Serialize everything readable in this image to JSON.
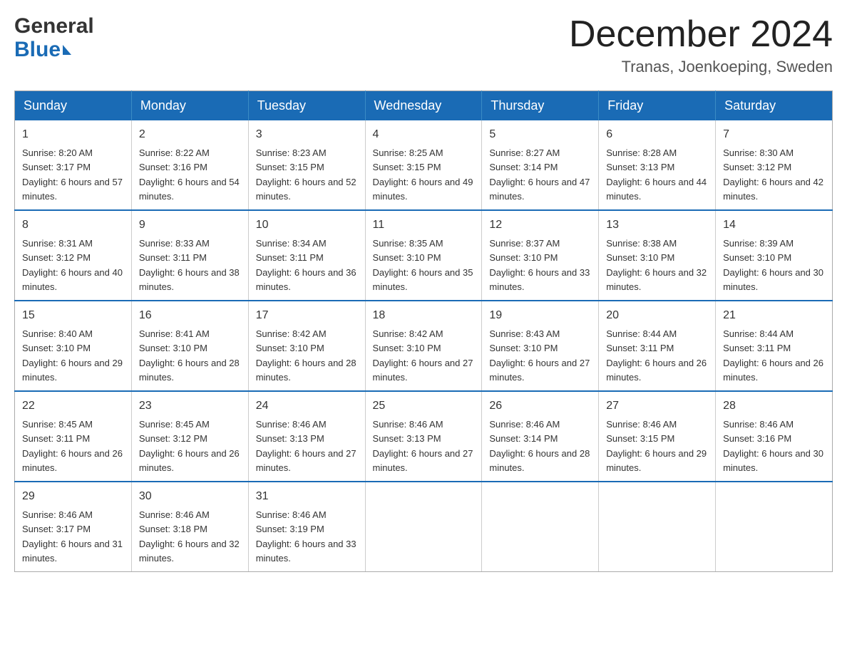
{
  "header": {
    "logo_line1": "General",
    "logo_line2": "Blue",
    "month_title": "December 2024",
    "location": "Tranas, Joenkoeping, Sweden"
  },
  "weekdays": [
    "Sunday",
    "Monday",
    "Tuesday",
    "Wednesday",
    "Thursday",
    "Friday",
    "Saturday"
  ],
  "weeks": [
    [
      {
        "day": "1",
        "sunrise": "8:20 AM",
        "sunset": "3:17 PM",
        "daylight": "6 hours and 57 minutes."
      },
      {
        "day": "2",
        "sunrise": "8:22 AM",
        "sunset": "3:16 PM",
        "daylight": "6 hours and 54 minutes."
      },
      {
        "day": "3",
        "sunrise": "8:23 AM",
        "sunset": "3:15 PM",
        "daylight": "6 hours and 52 minutes."
      },
      {
        "day": "4",
        "sunrise": "8:25 AM",
        "sunset": "3:15 PM",
        "daylight": "6 hours and 49 minutes."
      },
      {
        "day": "5",
        "sunrise": "8:27 AM",
        "sunset": "3:14 PM",
        "daylight": "6 hours and 47 minutes."
      },
      {
        "day": "6",
        "sunrise": "8:28 AM",
        "sunset": "3:13 PM",
        "daylight": "6 hours and 44 minutes."
      },
      {
        "day": "7",
        "sunrise": "8:30 AM",
        "sunset": "3:12 PM",
        "daylight": "6 hours and 42 minutes."
      }
    ],
    [
      {
        "day": "8",
        "sunrise": "8:31 AM",
        "sunset": "3:12 PM",
        "daylight": "6 hours and 40 minutes."
      },
      {
        "day": "9",
        "sunrise": "8:33 AM",
        "sunset": "3:11 PM",
        "daylight": "6 hours and 38 minutes."
      },
      {
        "day": "10",
        "sunrise": "8:34 AM",
        "sunset": "3:11 PM",
        "daylight": "6 hours and 36 minutes."
      },
      {
        "day": "11",
        "sunrise": "8:35 AM",
        "sunset": "3:10 PM",
        "daylight": "6 hours and 35 minutes."
      },
      {
        "day": "12",
        "sunrise": "8:37 AM",
        "sunset": "3:10 PM",
        "daylight": "6 hours and 33 minutes."
      },
      {
        "day": "13",
        "sunrise": "8:38 AM",
        "sunset": "3:10 PM",
        "daylight": "6 hours and 32 minutes."
      },
      {
        "day": "14",
        "sunrise": "8:39 AM",
        "sunset": "3:10 PM",
        "daylight": "6 hours and 30 minutes."
      }
    ],
    [
      {
        "day": "15",
        "sunrise": "8:40 AM",
        "sunset": "3:10 PM",
        "daylight": "6 hours and 29 minutes."
      },
      {
        "day": "16",
        "sunrise": "8:41 AM",
        "sunset": "3:10 PM",
        "daylight": "6 hours and 28 minutes."
      },
      {
        "day": "17",
        "sunrise": "8:42 AM",
        "sunset": "3:10 PM",
        "daylight": "6 hours and 28 minutes."
      },
      {
        "day": "18",
        "sunrise": "8:42 AM",
        "sunset": "3:10 PM",
        "daylight": "6 hours and 27 minutes."
      },
      {
        "day": "19",
        "sunrise": "8:43 AM",
        "sunset": "3:10 PM",
        "daylight": "6 hours and 27 minutes."
      },
      {
        "day": "20",
        "sunrise": "8:44 AM",
        "sunset": "3:11 PM",
        "daylight": "6 hours and 26 minutes."
      },
      {
        "day": "21",
        "sunrise": "8:44 AM",
        "sunset": "3:11 PM",
        "daylight": "6 hours and 26 minutes."
      }
    ],
    [
      {
        "day": "22",
        "sunrise": "8:45 AM",
        "sunset": "3:11 PM",
        "daylight": "6 hours and 26 minutes."
      },
      {
        "day": "23",
        "sunrise": "8:45 AM",
        "sunset": "3:12 PM",
        "daylight": "6 hours and 26 minutes."
      },
      {
        "day": "24",
        "sunrise": "8:46 AM",
        "sunset": "3:13 PM",
        "daylight": "6 hours and 27 minutes."
      },
      {
        "day": "25",
        "sunrise": "8:46 AM",
        "sunset": "3:13 PM",
        "daylight": "6 hours and 27 minutes."
      },
      {
        "day": "26",
        "sunrise": "8:46 AM",
        "sunset": "3:14 PM",
        "daylight": "6 hours and 28 minutes."
      },
      {
        "day": "27",
        "sunrise": "8:46 AM",
        "sunset": "3:15 PM",
        "daylight": "6 hours and 29 minutes."
      },
      {
        "day": "28",
        "sunrise": "8:46 AM",
        "sunset": "3:16 PM",
        "daylight": "6 hours and 30 minutes."
      }
    ],
    [
      {
        "day": "29",
        "sunrise": "8:46 AM",
        "sunset": "3:17 PM",
        "daylight": "6 hours and 31 minutes."
      },
      {
        "day": "30",
        "sunrise": "8:46 AM",
        "sunset": "3:18 PM",
        "daylight": "6 hours and 32 minutes."
      },
      {
        "day": "31",
        "sunrise": "8:46 AM",
        "sunset": "3:19 PM",
        "daylight": "6 hours and 33 minutes."
      },
      null,
      null,
      null,
      null
    ]
  ]
}
